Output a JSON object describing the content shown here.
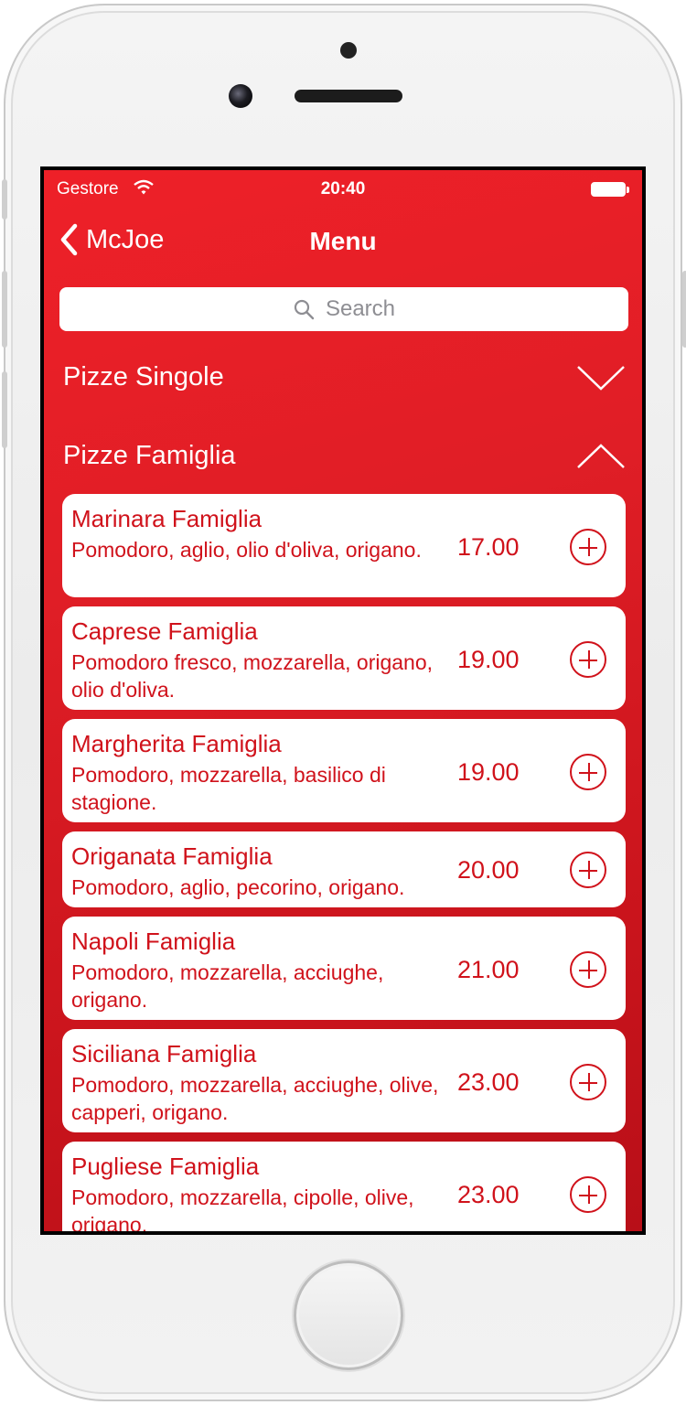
{
  "status_bar": {
    "carrier": "Gestore",
    "time": "20:40"
  },
  "nav": {
    "back_label": "McJoe",
    "title": "Menu"
  },
  "search": {
    "placeholder": "Search"
  },
  "sections": [
    {
      "label": "Pizze Singole",
      "state": "collapsed"
    },
    {
      "label": "Pizze Famiglia",
      "state": "expanded"
    }
  ],
  "items": [
    {
      "name": "Marinara Famiglia",
      "desc": "Pomodoro, aglio, olio d'oliva, origano.",
      "price": "17.00"
    },
    {
      "name": "Caprese Famiglia",
      "desc": "Pomodoro fresco, mozzarella, origano, olio d'oliva.",
      "price": "19.00"
    },
    {
      "name": "Margherita Famiglia",
      "desc": "Pomodoro, mozzarella, basilico di stagione.",
      "price": "19.00"
    },
    {
      "name": "Origanata Famiglia",
      "desc": "Pomodoro, aglio, pecorino, origano.",
      "price": "20.00"
    },
    {
      "name": "Napoli Famiglia",
      "desc": "Pomodoro, mozzarella, acciughe, origano.",
      "price": "21.00"
    },
    {
      "name": "Siciliana Famiglia",
      "desc": "Pomodoro, mozzarella, acciughe, olive, capperi, origano.",
      "price": "23.00"
    },
    {
      "name": "Pugliese Famiglia",
      "desc": "Pomodoro, mozzarella, cipolle, olive, origano.",
      "price": "23.00"
    }
  ],
  "colors": {
    "background": "#e01e26",
    "card": "#ffffff",
    "accent_text": "#d0121b"
  }
}
